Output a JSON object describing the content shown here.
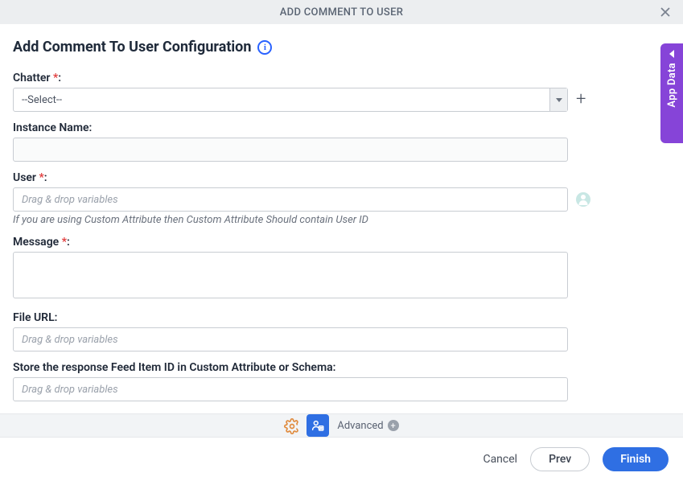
{
  "header": {
    "title": "ADD COMMENT TO USER"
  },
  "page": {
    "title": "Add Comment To User Configuration"
  },
  "side_tab": {
    "label": "App Data"
  },
  "fields": {
    "chatter": {
      "label": "Chatter ",
      "required": "*",
      "colon": ":",
      "value": "--Select--"
    },
    "instance": {
      "label": "Instance Name:"
    },
    "user": {
      "label": "User ",
      "required": "*",
      "colon": ":",
      "placeholder": "Drag & drop variables",
      "hint": "If you are using Custom Attribute then Custom Attribute Should contain User ID"
    },
    "message": {
      "label": "Message ",
      "required": "*",
      "colon": ":"
    },
    "file_url": {
      "label": "File URL:",
      "placeholder": "Drag & drop variables"
    },
    "store": {
      "label": "Store the response Feed Item ID in Custom Attribute or Schema:",
      "placeholder": "Drag & drop variables"
    }
  },
  "toolbar": {
    "advanced": "Advanced"
  },
  "footer": {
    "cancel": "Cancel",
    "prev": "Prev",
    "finish": "Finish"
  }
}
